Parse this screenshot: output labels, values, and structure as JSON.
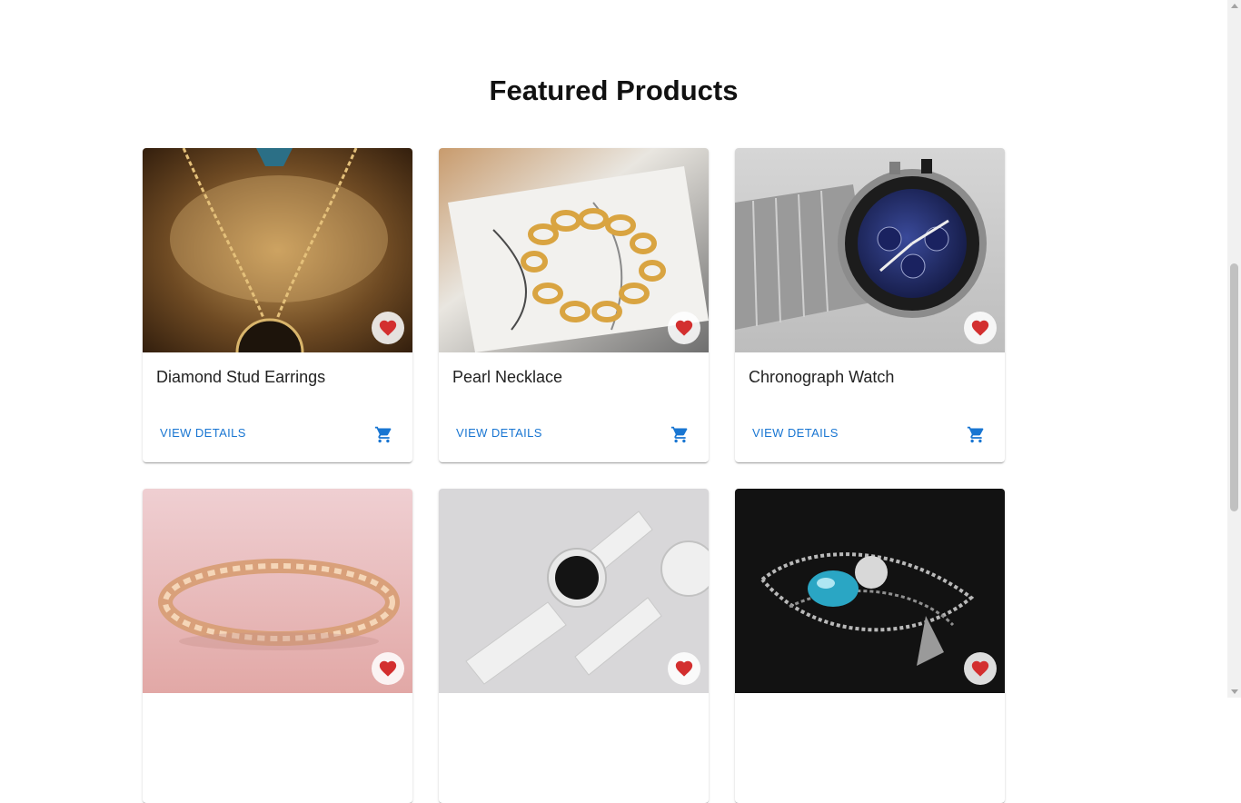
{
  "section": {
    "title": "Featured Products"
  },
  "colors": {
    "accent": "#1976d2",
    "favorite": "#d32f2f"
  },
  "icons": {
    "favorite": "heart-icon",
    "cart": "shopping-cart-icon"
  },
  "products": [
    {
      "name": "Diamond Stud Earrings",
      "action_label": "View Details",
      "image": "gold-chain-pendant-photo"
    },
    {
      "name": "Pearl Necklace",
      "action_label": "View Details",
      "image": "gold-chain-bracelet-photo"
    },
    {
      "name": "Chronograph Watch",
      "action_label": "View Details",
      "image": "steel-chronograph-watch-photo"
    },
    {
      "name": "",
      "action_label": "",
      "image": "rose-gold-bracelet-photo"
    },
    {
      "name": "",
      "action_label": "",
      "image": "white-smartwatch-photo"
    },
    {
      "name": "",
      "action_label": "",
      "image": "silver-chain-gemstone-photo"
    }
  ]
}
